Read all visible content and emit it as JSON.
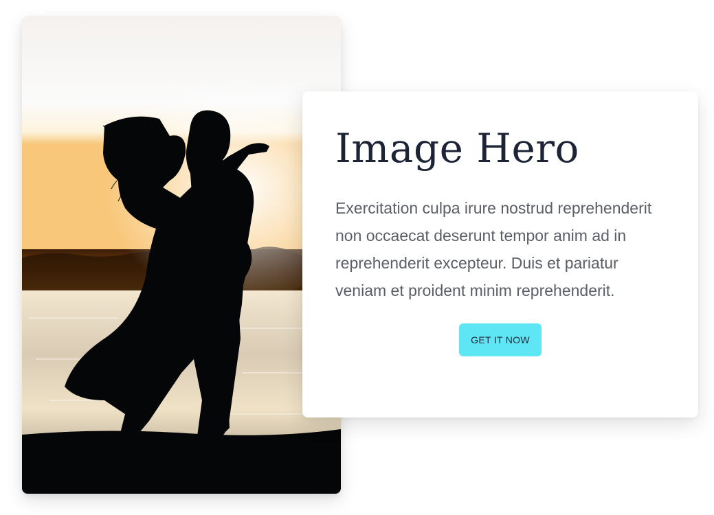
{
  "hero": {
    "title": "Image Hero",
    "body": "Exercitation culpa irure nostrud reprehenderit non occaecat deserunt tempor anim ad in reprehenderit excepteur. Duis et pariatur veniam et proident minim reprehenderit.",
    "cta_label": "GET IT NOW"
  },
  "image": {
    "subject": "couple-silhouette-sunset-lake"
  },
  "colors": {
    "cta_background": "#5ee6f5",
    "title": "#1c2436",
    "body": "#5b5e66"
  }
}
